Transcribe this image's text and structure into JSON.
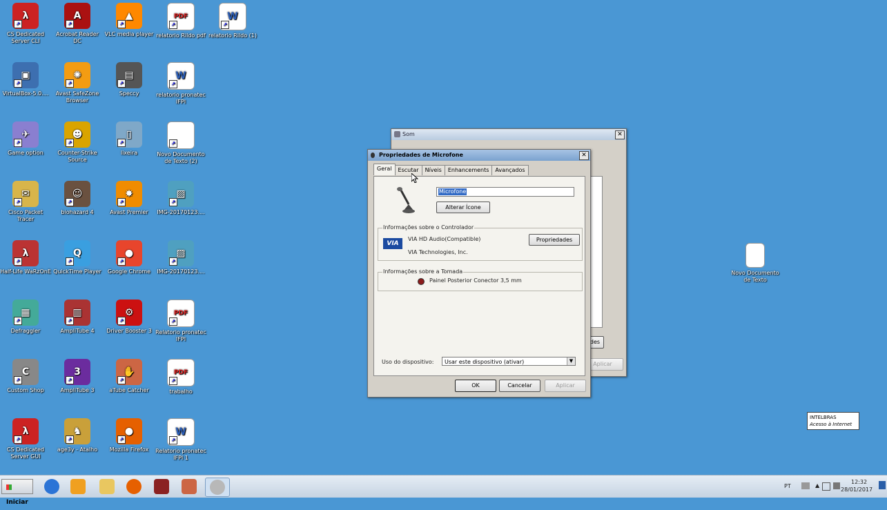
{
  "desktop_icons": [
    {
      "label": "CS Dedicated Server CLI",
      "color": "#c22",
      "glyph": "λ"
    },
    {
      "label": "Acrobat Reader DC",
      "color": "#a11",
      "glyph": "A"
    },
    {
      "label": "VLC media player",
      "color": "#f80",
      "glyph": "▲"
    },
    {
      "label": "relatorio Rildo pdf",
      "color": "#fff",
      "glyph": "PDF"
    },
    {
      "label": "relatorio Rildo (1)",
      "color": "#fff",
      "glyph": "W"
    },
    {
      "label": "VirtualBox-5.0....",
      "color": "#3d6fb0",
      "glyph": "▣"
    },
    {
      "label": "Avast SafeZone Browser",
      "color": "#f39c12",
      "glyph": "✺"
    },
    {
      "label": "Speccy",
      "color": "#555",
      "glyph": "▤"
    },
    {
      "label": "relatorio pronatec IFPI",
      "color": "#fff",
      "glyph": "W"
    },
    {
      "label": "Game option",
      "color": "#8a7fd0",
      "glyph": "✈"
    },
    {
      "label": "Counter-Strike Source",
      "color": "#d9a400",
      "glyph": "☻"
    },
    {
      "label": "lixeira",
      "color": "#7fa8c8",
      "glyph": "▯"
    },
    {
      "label": "Novo Documento de Texto (2)",
      "color": "#fff",
      "glyph": ""
    },
    {
      "label": "Cisco Packet Tracer",
      "color": "#d8b54a",
      "glyph": "✉"
    },
    {
      "label": "biohazard 4",
      "color": "#6a5140",
      "glyph": "☺"
    },
    {
      "label": "Avast Premier",
      "color": "#f08c00",
      "glyph": "✸"
    },
    {
      "label": "IMG-20170123....",
      "color": "#4fa0c0",
      "glyph": "▨"
    },
    {
      "label": "Half-Life WaRzOnE",
      "color": "#b33",
      "glyph": "λ"
    },
    {
      "label": "QuickTime Player",
      "color": "#3a9fe0",
      "glyph": "Q"
    },
    {
      "label": "Google Chrome",
      "color": "#e8452c",
      "glyph": "●"
    },
    {
      "label": "IMG-20170123....",
      "color": "#4fa0c0",
      "glyph": "▨"
    },
    {
      "label": "Defraggler",
      "color": "#4a9",
      "glyph": "▦"
    },
    {
      "label": "AmpliTube 4",
      "color": "#a33",
      "glyph": "▥"
    },
    {
      "label": "Driver Booster 3",
      "color": "#c11",
      "glyph": "⚙"
    },
    {
      "label": "Relatorio pronatec IFPI",
      "color": "#fff",
      "glyph": "PDF"
    },
    {
      "label": "Custom Shop",
      "color": "#888",
      "glyph": "C"
    },
    {
      "label": "AmpliTube 3",
      "color": "#6b2c9e",
      "glyph": "3"
    },
    {
      "label": "aTube Catcher",
      "color": "#c64",
      "glyph": "✋"
    },
    {
      "label": "trabalho",
      "color": "#fff",
      "glyph": "PDF"
    },
    {
      "label": "CS Dedicated Server GUI",
      "color": "#c22",
      "glyph": "λ"
    },
    {
      "label": "age3y - Atalho",
      "color": "#c9a03a",
      "glyph": "♞"
    },
    {
      "label": "Mozilla Firefox",
      "color": "#e66000",
      "glyph": "●"
    },
    {
      "label": "Relatorio pronatec IFPI 1",
      "color": "#fff",
      "glyph": "W"
    }
  ],
  "right_desktop_icon": {
    "label": "Novo Documento de Texto"
  },
  "som_window": {
    "title": "Som",
    "apply": "Aplicar",
    "partial_btn": "des"
  },
  "dialog": {
    "title": "Propriedades de Microfone",
    "tabs": [
      "Geral",
      "Escutar",
      "Níveis",
      "Enhancements",
      "Avançados"
    ],
    "device_name": "Microfone",
    "change_icon_btn": "Alterar Ícone",
    "controller_group": "Informações sobre o Controlador",
    "controller_name": "VIA HD Audio(Compatible)",
    "controller_vendor": "VIA Technologies, Inc.",
    "controller_logo": "VIA",
    "properties_btn": "Propriedades",
    "jack_group": "Informações sobre a Tomada",
    "jack_value": "Painel Posterior Conector 3,5 mm",
    "usage_label": "Uso do dispositivo:",
    "usage_value": "Usar este dispositivo (ativar)",
    "ok": "OK",
    "cancel": "Cancelar",
    "apply": "Aplicar"
  },
  "tooltip": {
    "line1": "INTELBRAS",
    "line2": "Acesso à Internet"
  },
  "taskbar": {
    "start_label": "Iniciar",
    "lang": "PT",
    "time": "12:32",
    "date": "28/01/2017"
  }
}
